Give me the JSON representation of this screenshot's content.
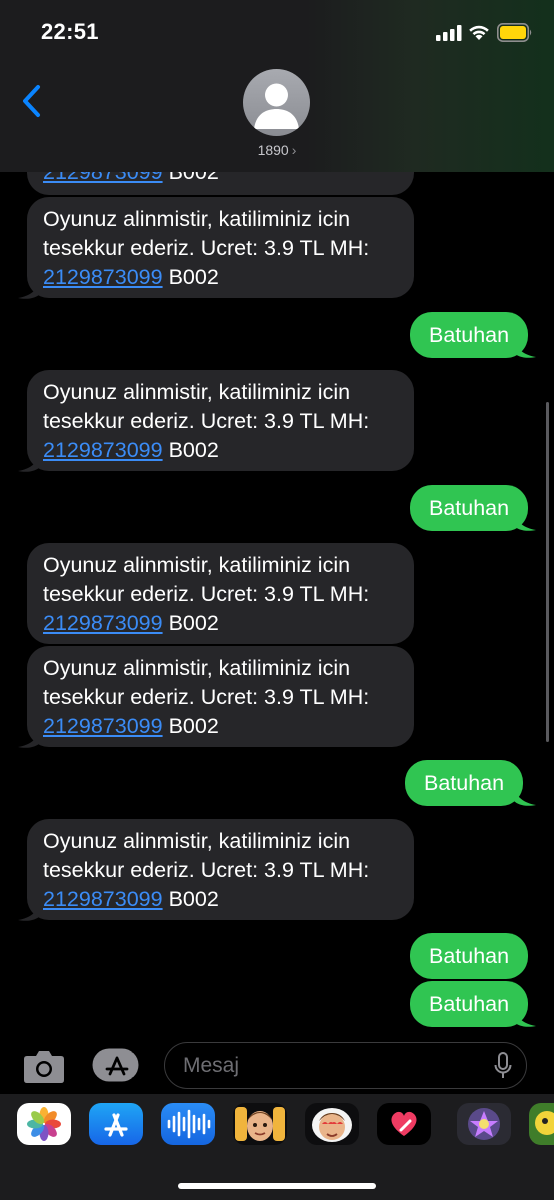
{
  "status_bar": {
    "time": "22:51"
  },
  "header": {
    "contact": "1890",
    "chevron": "›"
  },
  "messages": {
    "partial": {
      "number": "2129873099",
      "code": "B002"
    },
    "received_text": "Oyunuz alinmistir, katiliminiz icin tesekkur ederiz. Ucret: 3.9 TL MH:",
    "received_number": "2129873099",
    "received_code": "B002",
    "sent_text": "Batuhan"
  },
  "input": {
    "placeholder": "Mesaj"
  },
  "tray": {
    "icons": [
      "photos-app-icon",
      "app-store-icon",
      "audio-message-icon",
      "memoji-icon",
      "memoji-stickers-icon",
      "digital-touch-icon",
      "game-app-icon",
      "game-app-icon-2"
    ]
  },
  "colors": {
    "incoming_bubble": "#262629",
    "outgoing_bubble": "#30c552",
    "link": "#3b8cf6",
    "accent": "#0a84ff"
  }
}
